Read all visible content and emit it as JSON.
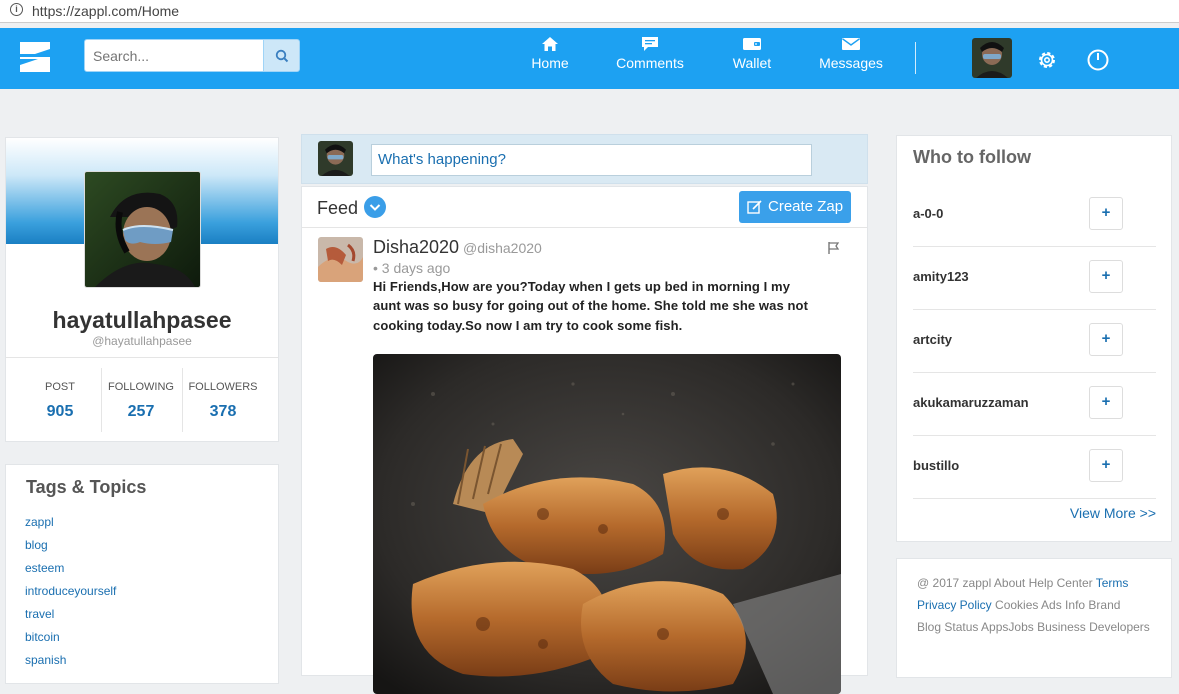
{
  "browser": {
    "url": "https://zappl.com/Home"
  },
  "navbar": {
    "search_placeholder": "Search...",
    "items": [
      {
        "label": "Home",
        "icon": "home-icon"
      },
      {
        "label": "Comments",
        "icon": "comments-icon"
      },
      {
        "label": "Wallet",
        "icon": "wallet-icon"
      },
      {
        "label": "Messages",
        "icon": "messages-icon"
      }
    ]
  },
  "profile": {
    "name": "hayatullahpasee",
    "handle": "@hayatullahpasee",
    "stats": [
      {
        "label": "POST",
        "value": "905"
      },
      {
        "label": "FOLLOWING",
        "value": "257"
      },
      {
        "label": "FOLLOWERS",
        "value": "378"
      }
    ]
  },
  "tags": {
    "title": "Tags & Topics",
    "items": [
      "zappl",
      "blog",
      "esteem",
      "introduceyourself",
      "travel",
      "bitcoin",
      "spanish"
    ]
  },
  "compose": {
    "placeholder": "What's happening?"
  },
  "feed": {
    "label": "Feed",
    "create_label": "Create Zap",
    "post": {
      "author": "Disha2020",
      "handle": "@disha2020",
      "time": "• 3 days ago",
      "lines": [
        "Hi Friends,How are you?Today when I gets up bed in morning I my",
        "aunt was so busy for going out of the home. She told me she was not",
        "cooking today.So now I am try to cook some fish."
      ]
    }
  },
  "who_to_follow": {
    "title": "Who to follow",
    "users": [
      "a-0-0",
      "amity123",
      "artcity",
      "akukamaruzzaman",
      "bustillo"
    ],
    "follow_label": "+",
    "view_more": "View More >>"
  },
  "footer": {
    "lines": [
      [
        {
          "text": "@ 2017 zappl About Help Center ",
          "link": false
        },
        {
          "text": "Terms",
          "link": true
        }
      ],
      [
        {
          "text": "Privacy Policy",
          "link": true
        },
        {
          "text": " Cookies Ads Info Brand",
          "link": false
        }
      ],
      [
        {
          "text": "Blog Status AppsJobs Business Developers",
          "link": false
        }
      ]
    ]
  },
  "colors": {
    "brand": "#1da1f2",
    "link": "#1a6fb0",
    "button": "#3aa0ea"
  }
}
